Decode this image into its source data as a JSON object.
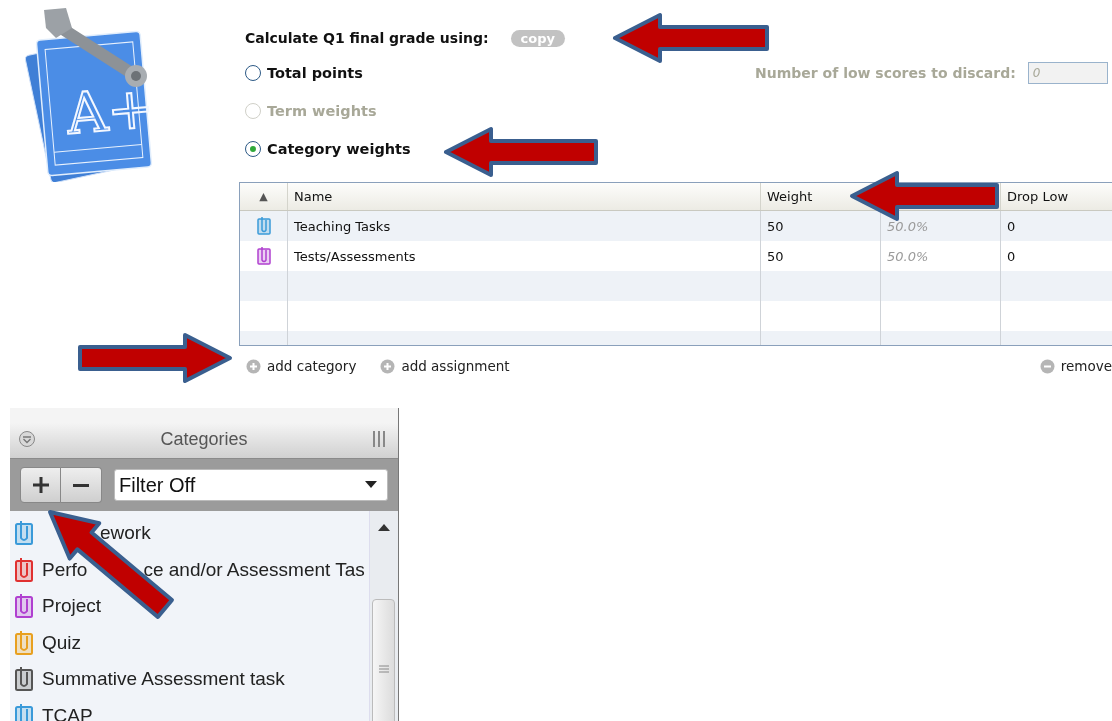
{
  "logo": {
    "text": "A+"
  },
  "header": {
    "title": "Calculate Q1 final grade using:",
    "copy_button": "copy"
  },
  "methods": [
    {
      "label": "Total points",
      "selected": false,
      "disabled": false
    },
    {
      "label": "Term weights",
      "selected": false,
      "disabled": true
    },
    {
      "label": "Category weights",
      "selected": true,
      "disabled": false
    }
  ],
  "discard": {
    "label": "Number of low scores to discard:",
    "value": "0",
    "disabled": true
  },
  "table": {
    "sort_indicator": "▲",
    "columns": [
      "Name",
      "Weight",
      "Drop Low"
    ],
    "rows": [
      {
        "color": "#3a9ad9",
        "name": "Teaching Tasks",
        "weight": "50",
        "percent": "50.0%",
        "drop_low": "0"
      },
      {
        "color": "#b040d0",
        "name": "Tests/Assessments",
        "weight": "50",
        "percent": "50.0%",
        "drop_low": "0"
      }
    ]
  },
  "actions": [
    "add category",
    "add assignment"
  ],
  "remove_action": "remove",
  "categories_panel": {
    "title": "Categories",
    "filter": "Filter Off",
    "items": [
      {
        "name_end": "ework",
        "color": "#3a9ad9"
      },
      {
        "name_start": "Perfo",
        "name_end": "ce and/or Assessment Tas",
        "color": "#e03030"
      },
      {
        "name": "Project",
        "color": "#b040d0"
      },
      {
        "name": "Quiz",
        "color": "#e8a020"
      },
      {
        "name": "Summative Assessment task",
        "color": "#555555"
      },
      {
        "name": "TCAP",
        "color": "#3a9ad9"
      }
    ]
  }
}
